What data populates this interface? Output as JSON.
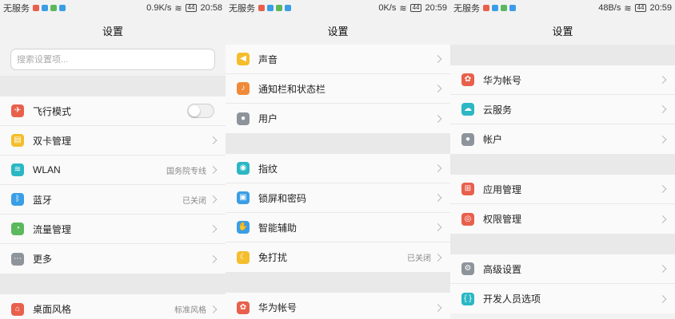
{
  "colors": {
    "red": "#e8604c",
    "yellow": "#f4bd2b",
    "teal": "#2bb7c4",
    "blue": "#3a9ee6",
    "green": "#5cb85c",
    "gray": "#8e949b",
    "orange": "#f08a3a"
  },
  "panels": [
    {
      "status": {
        "carrier": "无服务",
        "speed": "0.9K/s",
        "battery": "44",
        "time": "20:58"
      },
      "title": "设置",
      "search_placeholder": "搜索设置项...",
      "items": [
        {
          "label": "飞行模式",
          "icon": "airplane-icon",
          "toggle": true,
          "toggle_on": false
        },
        {
          "label": "双卡管理",
          "icon": "sim-card-icon"
        },
        {
          "label": "WLAN",
          "icon": "wifi-icon",
          "value": "国务院专线"
        },
        {
          "label": "蓝牙",
          "icon": "bluetooth-icon",
          "value": "已关闭"
        },
        {
          "label": "流量管理",
          "icon": "data-usage-icon"
        },
        {
          "label": "更多",
          "icon": "more-icon"
        },
        {
          "label": "桌面风格",
          "icon": "home-icon",
          "value": "标准风格"
        }
      ]
    },
    {
      "status": {
        "carrier": "无服务",
        "speed": "0K/s",
        "battery": "44",
        "time": "20:59"
      },
      "title": "设置",
      "items": [
        {
          "label": "声音",
          "icon": "sound-icon"
        },
        {
          "label": "通知栏和状态栏",
          "icon": "bell-icon"
        },
        {
          "label": "用户",
          "icon": "user-icon"
        },
        {
          "label": "指纹",
          "icon": "fingerprint-icon"
        },
        {
          "label": "锁屏和密码",
          "icon": "lock-icon"
        },
        {
          "label": "智能辅助",
          "icon": "hand-icon"
        },
        {
          "label": "免打扰",
          "icon": "moon-icon",
          "value": "已关闭"
        },
        {
          "label": "华为帐号",
          "icon": "huawei-icon"
        }
      ]
    },
    {
      "status": {
        "carrier": "无服务",
        "speed": "48B/s",
        "battery": "44",
        "time": "20:59"
      },
      "title": "设置",
      "items": [
        {
          "label": "华为帐号",
          "icon": "huawei-icon"
        },
        {
          "label": "云服务",
          "icon": "cloud-icon"
        },
        {
          "label": "帐户",
          "icon": "account-icon"
        },
        {
          "label": "应用管理",
          "icon": "apps-icon"
        },
        {
          "label": "权限管理",
          "icon": "permission-icon"
        },
        {
          "label": "高级设置",
          "icon": "gear-icon"
        },
        {
          "label": "开发人员选项",
          "icon": "developer-icon"
        }
      ]
    }
  ]
}
